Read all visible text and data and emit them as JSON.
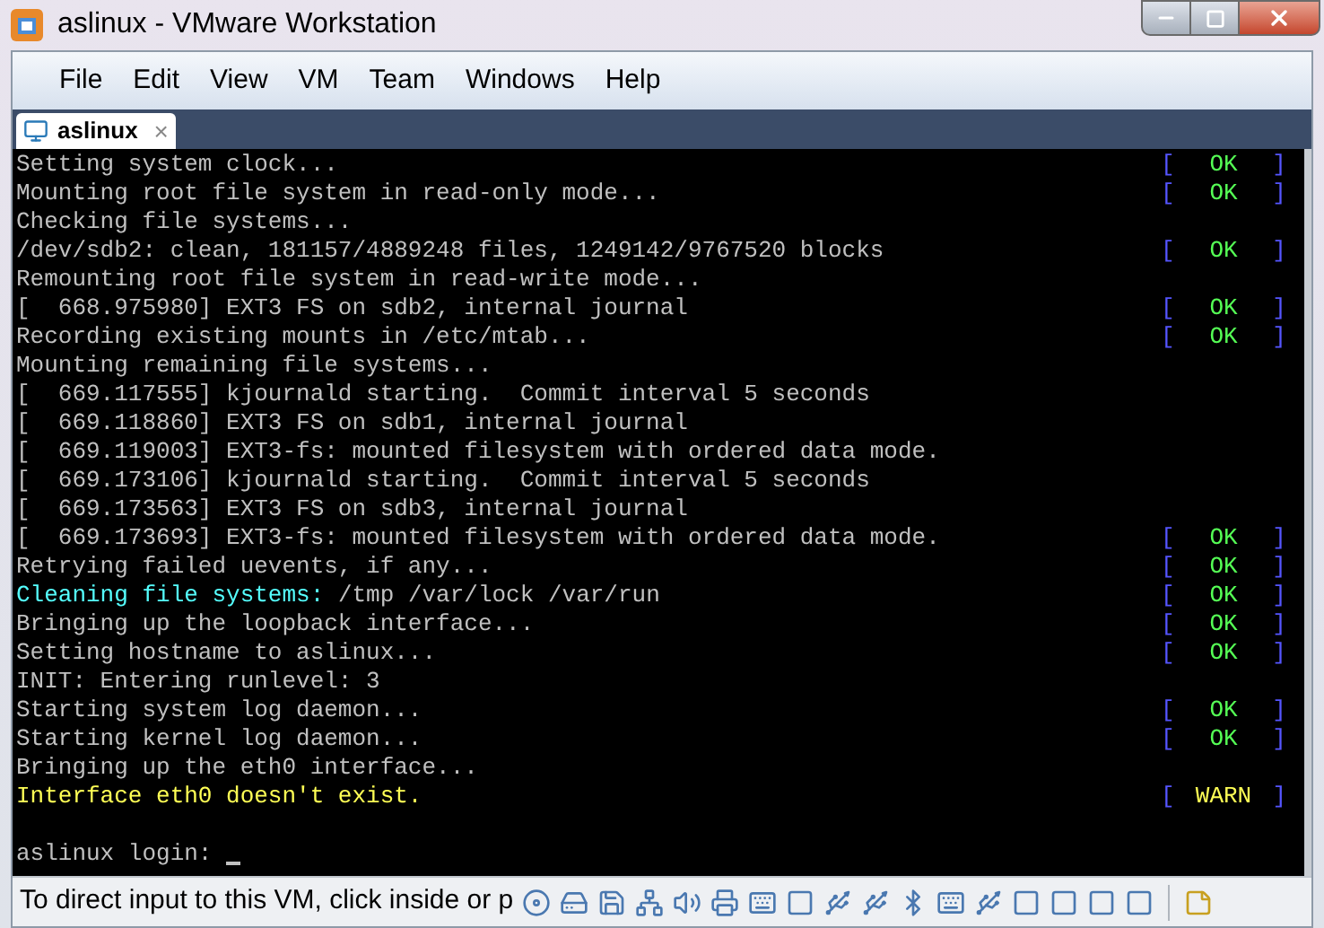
{
  "window": {
    "title": "aslinux - VMware Workstation"
  },
  "menu": [
    "File",
    "Edit",
    "View",
    "VM",
    "Team",
    "Windows",
    "Help"
  ],
  "tabs": [
    {
      "label": "aslinux",
      "selected": true,
      "close": "×"
    }
  ],
  "console": {
    "lines": [
      {
        "kind": "text",
        "segments": [
          {
            "text": "Setting system clock...",
            "color": "#c0c0c0"
          }
        ],
        "status": {
          "open": "[",
          "label": "OK",
          "close": "]",
          "color": "#55ff55"
        }
      },
      {
        "kind": "text",
        "segments": [
          {
            "text": "Mounting root file system in read-only mode...",
            "color": "#c0c0c0"
          }
        ],
        "status": {
          "open": "[",
          "label": "OK",
          "close": "]",
          "color": "#55ff55"
        }
      },
      {
        "kind": "text",
        "segments": [
          {
            "text": "Checking file systems...",
            "color": "#c0c0c0"
          }
        ]
      },
      {
        "kind": "text",
        "segments": [
          {
            "text": "/dev/sdb2: clean, 181157/4889248 files, 1249142/9767520 blocks",
            "color": "#c0c0c0"
          }
        ],
        "status": {
          "open": "[",
          "label": "OK",
          "close": "]",
          "color": "#55ff55"
        }
      },
      {
        "kind": "text",
        "segments": [
          {
            "text": "Remounting root file system in read-write mode...",
            "color": "#c0c0c0"
          }
        ]
      },
      {
        "kind": "text",
        "segments": [
          {
            "text": "[  668.975980] EXT3 FS on sdb2, internal journal",
            "color": "#c0c0c0"
          }
        ],
        "status": {
          "open": "[",
          "label": "OK",
          "close": "]",
          "color": "#55ff55"
        }
      },
      {
        "kind": "text",
        "segments": [
          {
            "text": "Recording existing mounts in /etc/mtab...",
            "color": "#c0c0c0"
          }
        ],
        "status": {
          "open": "[",
          "label": "OK",
          "close": "]",
          "color": "#55ff55"
        }
      },
      {
        "kind": "text",
        "segments": [
          {
            "text": "Mounting remaining file systems...",
            "color": "#c0c0c0"
          }
        ]
      },
      {
        "kind": "text",
        "segments": [
          {
            "text": "[  669.117555] kjournald starting.  Commit interval 5 seconds",
            "color": "#c0c0c0"
          }
        ]
      },
      {
        "kind": "text",
        "segments": [
          {
            "text": "[  669.118860] EXT3 FS on sdb1, internal journal",
            "color": "#c0c0c0"
          }
        ]
      },
      {
        "kind": "text",
        "segments": [
          {
            "text": "[  669.119003] EXT3-fs: mounted filesystem with ordered data mode.",
            "color": "#c0c0c0"
          }
        ]
      },
      {
        "kind": "text",
        "segments": [
          {
            "text": "[  669.173106] kjournald starting.  Commit interval 5 seconds",
            "color": "#c0c0c0"
          }
        ]
      },
      {
        "kind": "text",
        "segments": [
          {
            "text": "[  669.173563] EXT3 FS on sdb3, internal journal",
            "color": "#c0c0c0"
          }
        ]
      },
      {
        "kind": "text",
        "segments": [
          {
            "text": "[  669.173693] EXT3-fs: mounted filesystem with ordered data mode.",
            "color": "#c0c0c0"
          }
        ],
        "status": {
          "open": "[",
          "label": "OK",
          "close": "]",
          "color": "#55ff55"
        }
      },
      {
        "kind": "text",
        "segments": [
          {
            "text": "Retrying failed uevents, if any...",
            "color": "#c0c0c0"
          }
        ],
        "status": {
          "open": "[",
          "label": "OK",
          "close": "]",
          "color": "#55ff55"
        }
      },
      {
        "kind": "text",
        "segments": [
          {
            "text": "Cleaning file systems:",
            "color": "#55ffff"
          },
          {
            "text": " /tmp /var/lock /var/run",
            "color": "#c0c0c0"
          }
        ],
        "status": {
          "open": "[",
          "label": "OK",
          "close": "]",
          "color": "#55ff55"
        }
      },
      {
        "kind": "text",
        "segments": [
          {
            "text": "Bringing up the loopback interface...",
            "color": "#c0c0c0"
          }
        ],
        "status": {
          "open": "[",
          "label": "OK",
          "close": "]",
          "color": "#55ff55"
        }
      },
      {
        "kind": "text",
        "segments": [
          {
            "text": "Setting hostname to aslinux...",
            "color": "#c0c0c0"
          }
        ],
        "status": {
          "open": "[",
          "label": "OK",
          "close": "]",
          "color": "#55ff55"
        }
      },
      {
        "kind": "text",
        "segments": [
          {
            "text": "INIT: Entering runlevel: 3",
            "color": "#c0c0c0"
          }
        ]
      },
      {
        "kind": "text",
        "segments": [
          {
            "text": "Starting system log daemon...",
            "color": "#c0c0c0"
          }
        ],
        "status": {
          "open": "[",
          "label": "OK",
          "close": "]",
          "color": "#55ff55"
        }
      },
      {
        "kind": "text",
        "segments": [
          {
            "text": "Starting kernel log daemon...",
            "color": "#c0c0c0"
          }
        ],
        "status": {
          "open": "[",
          "label": "OK",
          "close": "]",
          "color": "#55ff55"
        }
      },
      {
        "kind": "text",
        "segments": [
          {
            "text": "Bringing up the eth0 interface...",
            "color": "#c0c0c0"
          }
        ]
      },
      {
        "kind": "text",
        "segments": [
          {
            "text": "Interface eth0 doesn't exist.",
            "color": "#ffff55"
          }
        ],
        "status": {
          "open": "[",
          "label": "WARN",
          "close": "]",
          "color": "#ffff55"
        }
      },
      {
        "kind": "blank"
      },
      {
        "kind": "prompt",
        "segments": [
          {
            "text": "aslinux login: ",
            "color": "#c0c0c0"
          }
        ]
      }
    ]
  },
  "status_bar": {
    "message": "To direct input to this VM, click inside or p"
  }
}
